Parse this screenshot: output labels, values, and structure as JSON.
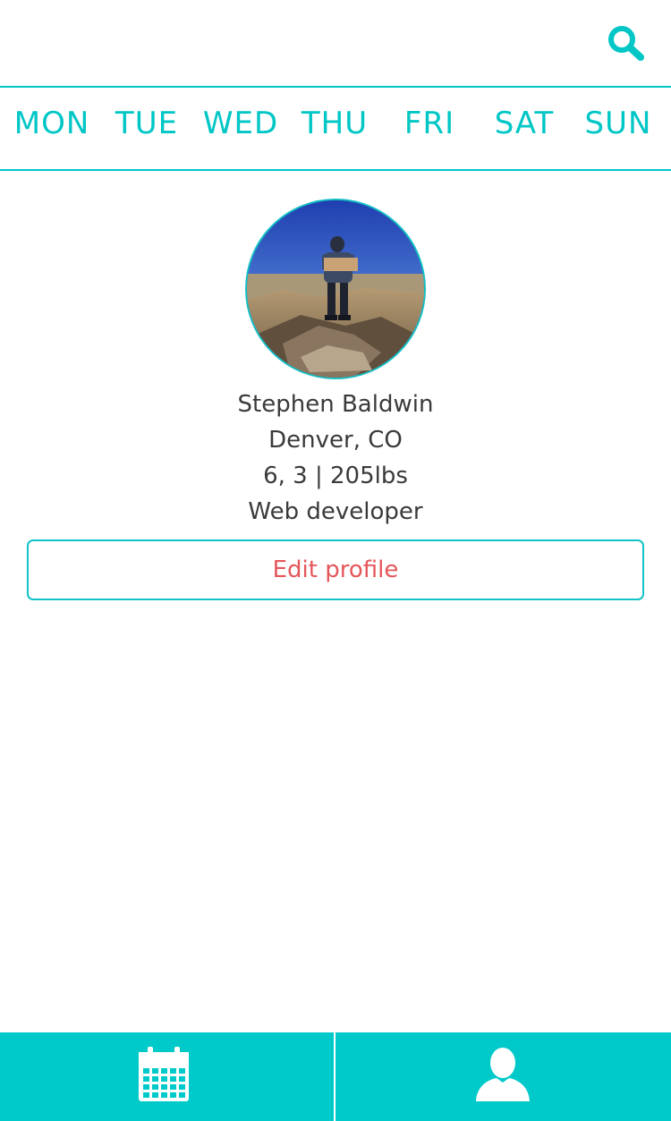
{
  "header": {
    "search_icon": "search-icon"
  },
  "days": [
    "MON",
    "TUE",
    "WED",
    "THU",
    "FRI",
    "SAT",
    "SUN"
  ],
  "profile": {
    "name": "Stephen Baldwin",
    "location": "Denver, CO",
    "stats": "6, 3 | 205lbs",
    "occupation": "Web developer",
    "edit_label": "Edit profile"
  },
  "bottom_nav": {
    "items": [
      {
        "icon": "calendar-icon"
      },
      {
        "icon": "user-icon"
      }
    ]
  },
  "colors": {
    "accent": "#00c6c6",
    "nav_background": "#00cac9",
    "edit_text": "#e4575b",
    "body_text": "#3a3a3a"
  }
}
